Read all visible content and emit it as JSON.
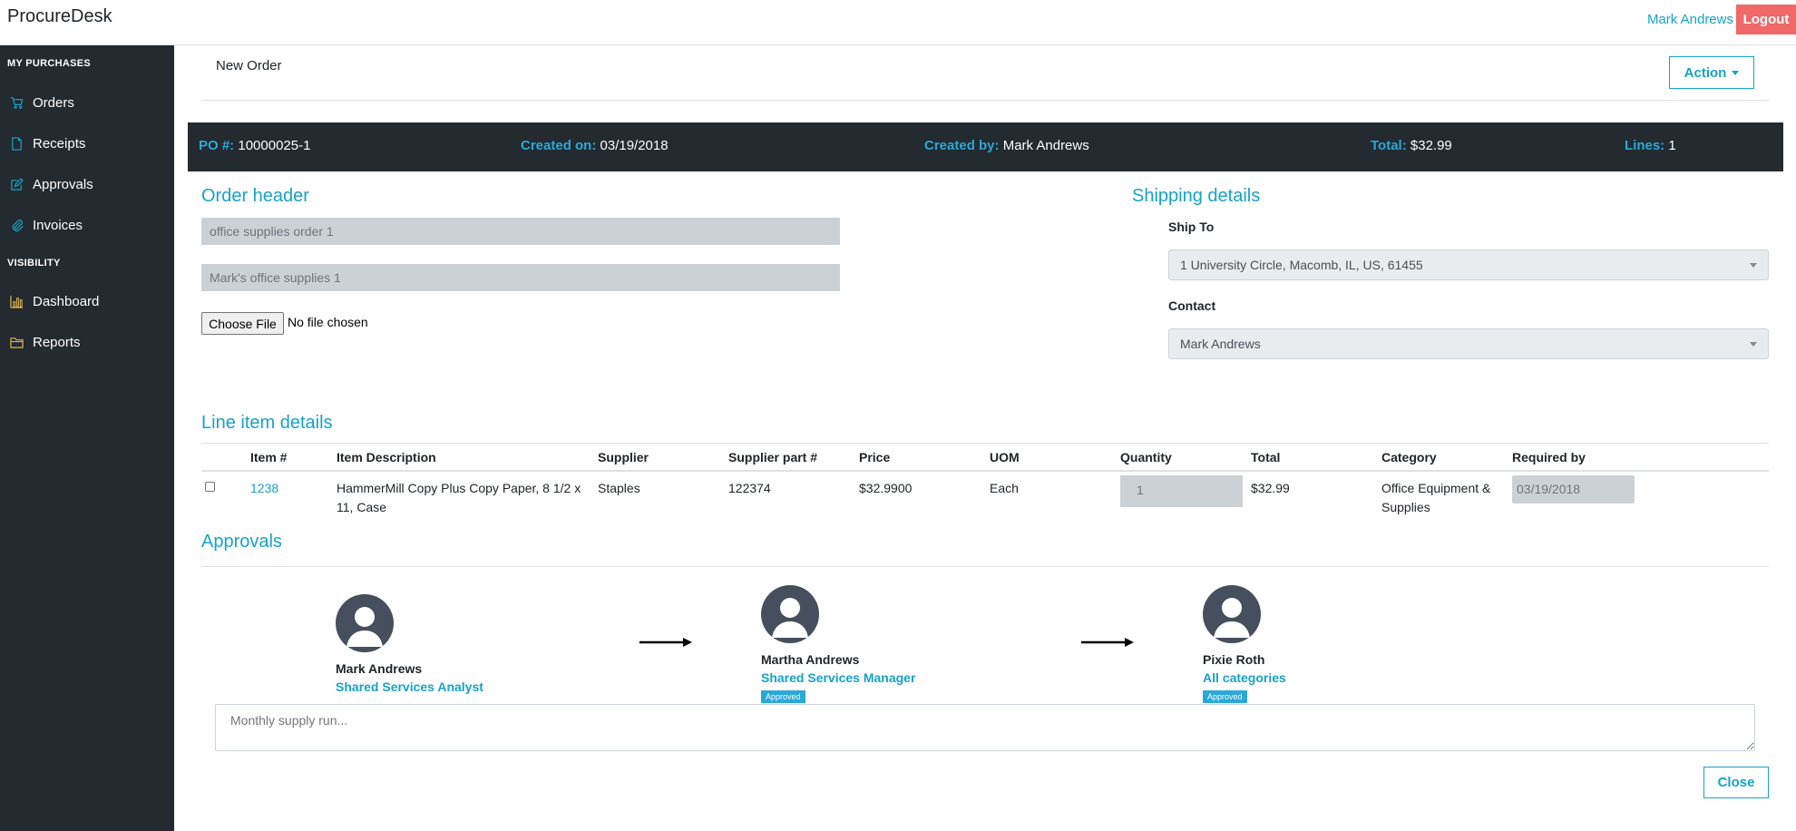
{
  "app": {
    "brand": "ProcureDesk"
  },
  "header": {
    "user_name": "Mark Andrews",
    "logout_label": "Logout"
  },
  "sidebar": {
    "sections": [
      {
        "title": "MY PURCHASES",
        "items": [
          {
            "label": "Orders",
            "icon": "cart-icon"
          },
          {
            "label": "Receipts",
            "icon": "document-icon"
          },
          {
            "label": "Approvals",
            "icon": "edit-icon"
          },
          {
            "label": "Invoices",
            "icon": "paperclip-icon"
          }
        ]
      },
      {
        "title": "VISIBILITY",
        "items": [
          {
            "label": "Dashboard",
            "icon": "bar-chart-icon"
          },
          {
            "label": "Reports",
            "icon": "folder-icon"
          }
        ]
      }
    ],
    "accent_colors": {
      "purchases": "#17a2c8",
      "visibility": "#e0b44b"
    }
  },
  "page": {
    "title": "New Order",
    "action_label": "Action"
  },
  "summary": {
    "po_label": "PO #:",
    "po_value": "10000025-1",
    "created_on_label": "Created on:",
    "created_on_value": "03/19/2018",
    "created_by_label": "Created by:",
    "created_by_value": "Mark Andrews",
    "total_label": "Total:",
    "total_value": "$32.99",
    "lines_label": "Lines:",
    "lines_value": "1"
  },
  "order_header": {
    "title": "Order header",
    "field1_value": "office supplies order 1",
    "field2_value": "Mark's office supplies 1",
    "file_button": "Choose File",
    "file_status": "No file chosen"
  },
  "shipping": {
    "title": "Shipping details",
    "ship_to_label": "Ship To",
    "ship_to_value": "1 University Circle, Macomb, IL, US, 61455",
    "contact_label": "Contact",
    "contact_value": "Mark Andrews"
  },
  "line_items": {
    "title": "Line item details",
    "columns": [
      "Item #",
      "Item Description",
      "Supplier",
      "Supplier part #",
      "Price",
      "UOM",
      "Quantity",
      "Total",
      "Category",
      "Required by"
    ],
    "rows": [
      {
        "item_no": "1238",
        "description": "HammerMill Copy Plus Copy Paper, 8 1/2 x 11, Case",
        "supplier": "Staples",
        "part_no": "122374",
        "price": "$32.9900",
        "uom": "Each",
        "quantity": "1",
        "total": "$32.99",
        "category": "Office Equipment & Supplies",
        "required_by": "03/19/2018"
      }
    ]
  },
  "approvals": {
    "title": "Approvals",
    "approvers": [
      {
        "name": "Mark Andrews",
        "role": "Shared Services Analyst",
        "status": ""
      },
      {
        "name": "Martha Andrews",
        "role": "Shared Services Manager",
        "status": "Approved"
      },
      {
        "name": "Pixie Roth",
        "role": "All categories",
        "status": "Approved"
      }
    ],
    "comment_placeholder": "Monthly supply run...",
    "close_label": "Close"
  }
}
